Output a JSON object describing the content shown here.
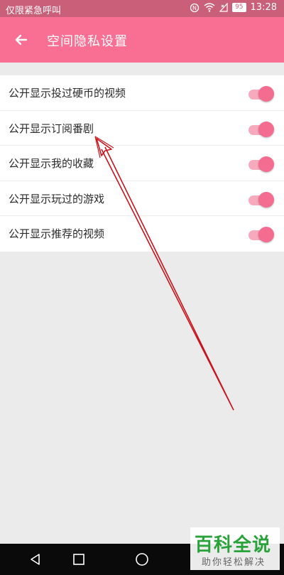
{
  "status_bar": {
    "carrier": "仅限紧急呼叫",
    "battery": "95",
    "time": "13:28"
  },
  "app_bar": {
    "title": "空间隐私设置"
  },
  "settings": [
    {
      "label": "公开显示投过硬币的视频",
      "enabled": true
    },
    {
      "label": "公开显示订阅番剧",
      "enabled": true
    },
    {
      "label": "公开显示我的收藏",
      "enabled": true
    },
    {
      "label": "公开显示玩过的游戏",
      "enabled": true
    },
    {
      "label": "公开显示推荐的视频",
      "enabled": true
    }
  ],
  "watermark": {
    "main": "百科全说",
    "sub": "助你轻松解决"
  },
  "colors": {
    "accent": "#f96f93",
    "status_bar": "#c95f78",
    "annotation_arrow": "#c8141c"
  }
}
